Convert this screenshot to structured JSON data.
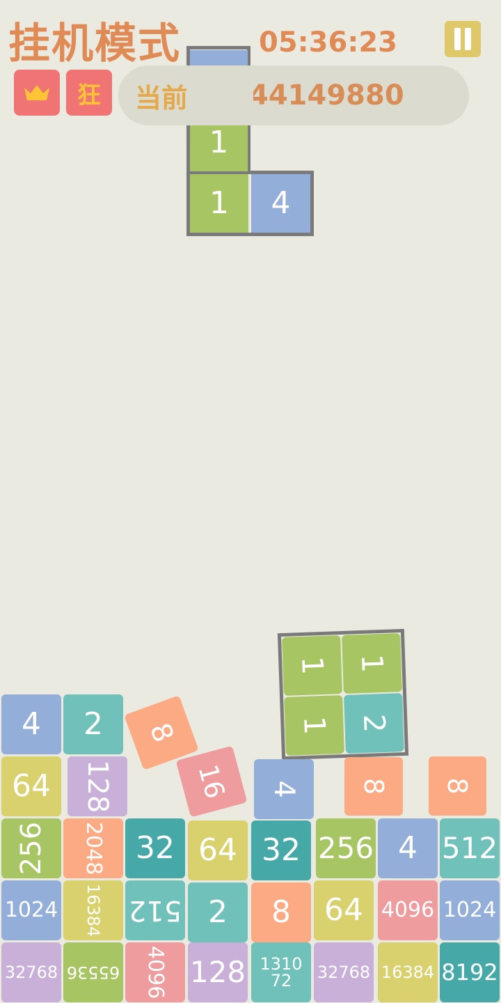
{
  "header": {
    "title": "挂机模式",
    "timer": "05:36:23",
    "crown_icon": "crown-icon",
    "mode_badge": "狂",
    "score_label": "当前得分",
    "score_value": "44149880"
  },
  "colors": {
    "background": "#ebeae0",
    "accent": "#e08a55",
    "badge": "#f17474",
    "pause": "#dfc86a"
  },
  "falling_piece": {
    "tiles": [
      "1",
      "1",
      "4"
    ]
  },
  "floating_piece": {
    "tiles": [
      "1",
      "1",
      "1",
      "2"
    ]
  },
  "loose_tiles": [
    "8",
    "16",
    "4",
    "8",
    "8"
  ],
  "board": {
    "row1": [
      "4",
      "2"
    ],
    "row2": [
      "64",
      "128"
    ],
    "row3": [
      "256",
      "2048",
      "32",
      "64",
      "32",
      "256",
      "4",
      "512"
    ],
    "row4": [
      "1024",
      "16384",
      "512",
      "2",
      "8",
      "64",
      "4096",
      "1024"
    ],
    "row5": [
      "32768",
      "65536",
      "4096",
      "128",
      "131072",
      "32768",
      "16384",
      "8192"
    ]
  }
}
